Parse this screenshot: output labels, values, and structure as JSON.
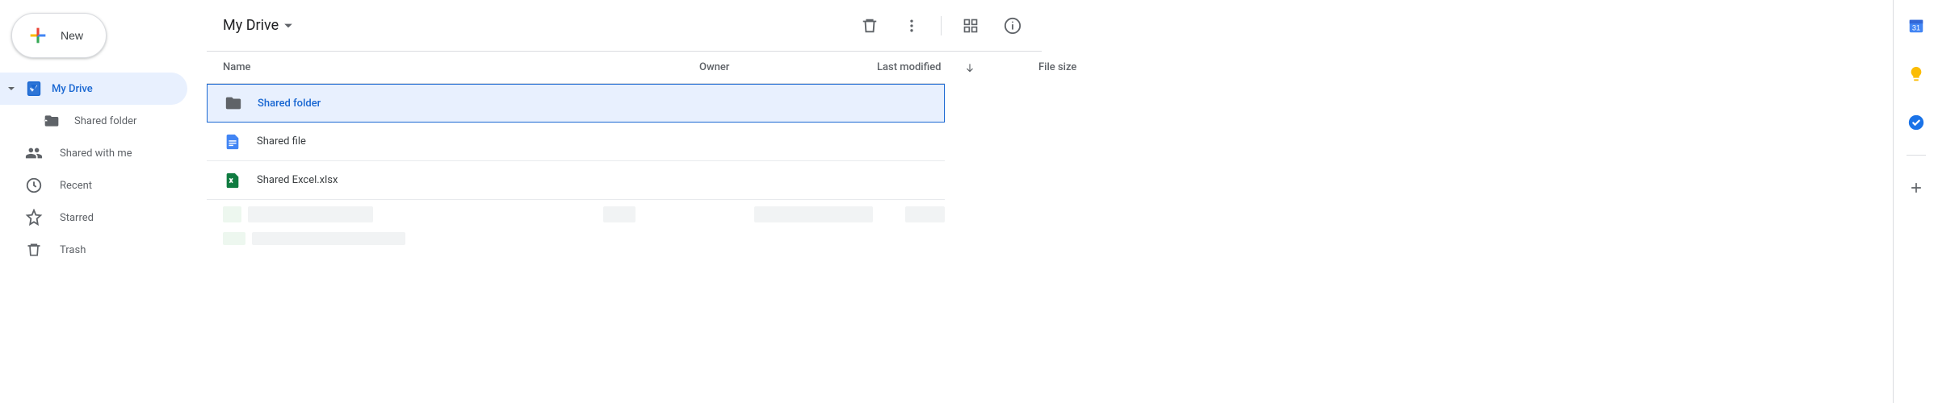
{
  "sidebar": {
    "new_label": "New",
    "items": [
      {
        "label": "My Drive",
        "icon": "drive-icon",
        "active": true,
        "expandable": true
      },
      {
        "label": "Shared folder",
        "icon": "shared-folder-icon",
        "child": true
      },
      {
        "label": "Shared with me",
        "icon": "people-icon"
      },
      {
        "label": "Recent",
        "icon": "clock-icon"
      },
      {
        "label": "Starred",
        "icon": "star-icon"
      },
      {
        "label": "Trash",
        "icon": "trash-icon"
      }
    ]
  },
  "header": {
    "breadcrumb": "My Drive",
    "actions": [
      "trash-icon",
      "more-icon",
      "grid-view-icon",
      "info-icon"
    ]
  },
  "columns": {
    "name": "Name",
    "owner": "Owner",
    "modified": "Last modified",
    "size": "File size"
  },
  "rows": [
    {
      "name": "Shared folder",
      "icon": "shared-folder-icon",
      "selected": true
    },
    {
      "name": "Shared file",
      "icon": "shared-doc-icon",
      "selected": false
    },
    {
      "name": "Shared Excel.xlsx",
      "icon": "shared-xlsx-icon",
      "selected": false
    }
  ],
  "side_panel": {
    "items": [
      "calendar-icon",
      "keep-icon",
      "tasks-icon",
      "add-icon"
    ]
  }
}
